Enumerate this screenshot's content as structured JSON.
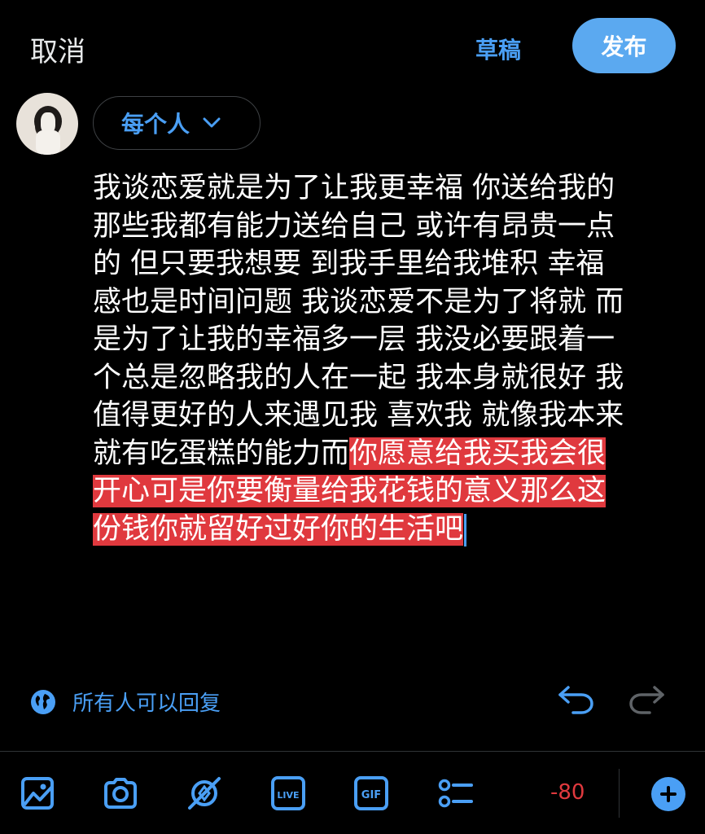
{
  "header": {
    "cancel_label": "取消",
    "drafts_label": "草稿",
    "post_label": "发布"
  },
  "audience": {
    "label": "每个人"
  },
  "post": {
    "lines": [
      "我谈恋爱就是为了让我更幸福 你送给我的",
      "那些我都有能力送给自己 或许有昂贵一点",
      "的 但只要我想要 到我手里给我堆积 幸福",
      "感也是时间问题 我谈恋爱不是为了将就 而",
      "是为了让我的幸福多一层 我没必要跟着一",
      "个总是忽略我的人在一起 我本身就很好 我",
      "值得更好的人来遇见我 喜欢我 就像我本来"
    ],
    "line8_plain": "就有吃蛋糕的能力而",
    "line8_selected": "你愿意给我买我会很",
    "line9_selected": "开心可是你要衡量给我花钱的意义那么这",
    "line10_selected": "份钱你就留好过好你的生活吧"
  },
  "reply_setting": {
    "label": "所有人可以回复"
  },
  "toolbar": {
    "char_counter": "-80",
    "live_label": "LIVE",
    "gif_label": "GIF"
  },
  "colors": {
    "accent": "#4a9ff5",
    "post_button": "#5ba9f0",
    "selection": "#e0393e",
    "counter_over": "#e0393e"
  },
  "icons": [
    "globe-icon",
    "undo-icon",
    "redo-icon",
    "image-icon",
    "camera-icon",
    "location-off-icon",
    "live-icon",
    "gif-icon",
    "poll-icon",
    "add-thread-icon",
    "chevron-down-icon"
  ]
}
